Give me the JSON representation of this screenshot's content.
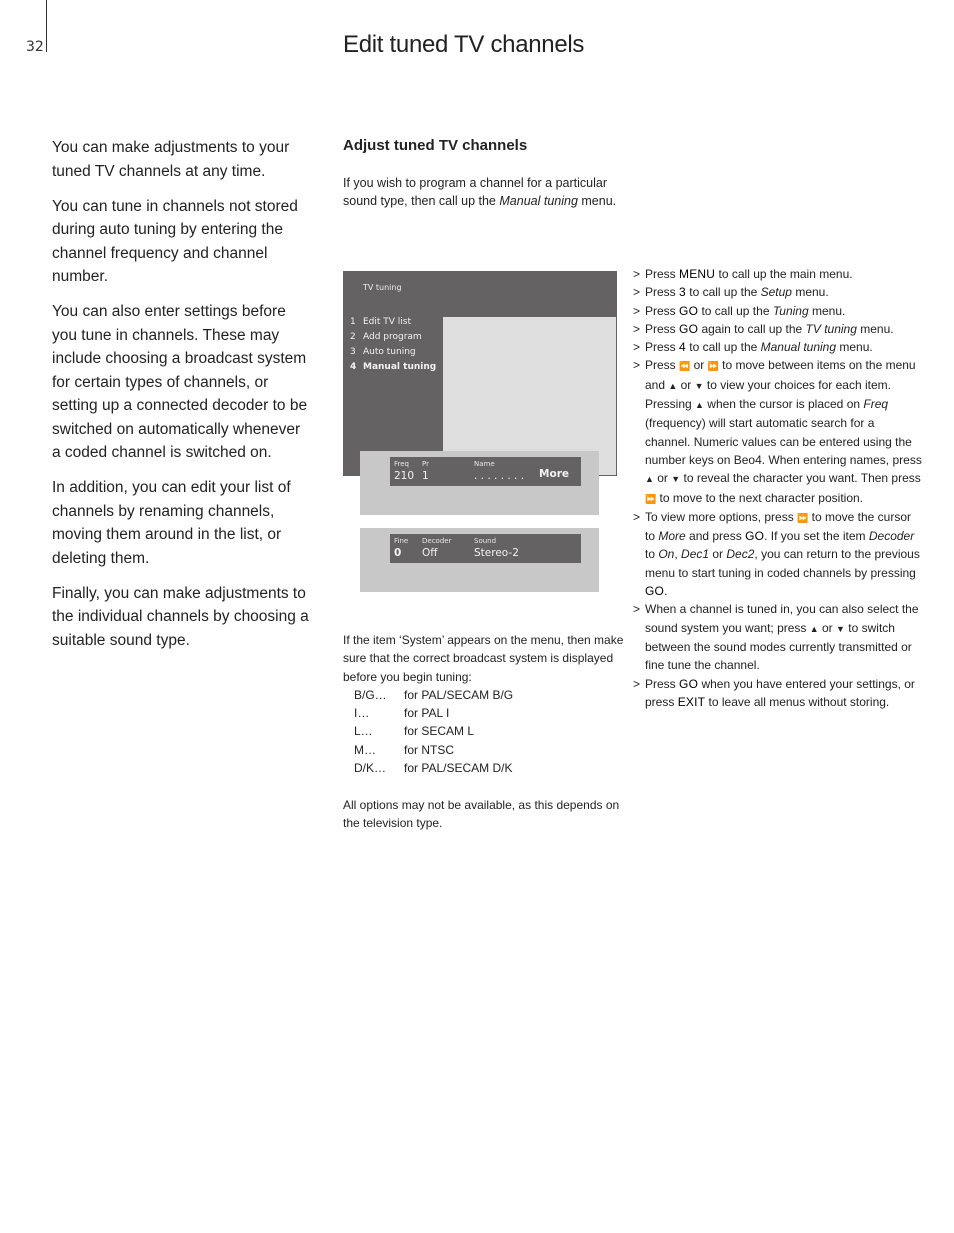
{
  "header": {
    "page_number": "32",
    "title": "Edit tuned TV channels"
  },
  "intro": {
    "paragraphs": [
      "You can make adjustments to your tuned TV channels at any time.",
      "You can tune in channels not stored during auto tuning by entering the channel frequency and channel number.",
      "You can also enter settings before you tune in channels. These may include choosing a broadcast system for certain types of channels, or setting up a connected decoder to be switched on automatically whenever a coded channel is switched on.",
      "In addition, you can edit your list of channels by renaming channels, moving them around in the list, or deleting them.",
      "Finally, you can make adjustments to the individual channels by choosing a suitable sound type."
    ]
  },
  "section": {
    "heading": "Adjust tuned TV channels",
    "lead_pre": "If you wish to program a channel for a particular sound type, then call up the ",
    "lead_em": "Manual tuning",
    "lead_post": " menu."
  },
  "tv_menu": {
    "title": "TV tuning",
    "items": [
      {
        "num": "1",
        "label": "Edit TV list"
      },
      {
        "num": "2",
        "label": "Add program"
      },
      {
        "num": "3",
        "label": "Auto tuning"
      },
      {
        "num": "4",
        "label": "Manual tuning"
      }
    ],
    "panel1": {
      "freq_label": "Freq",
      "freq_value": "210",
      "pr_label": "Pr",
      "pr_value": "1",
      "name_label": "Name",
      "name_value": ". . . . . . . .",
      "more_label": "More"
    },
    "panel2": {
      "fine_label": "Fine",
      "fine_value": "0",
      "decoder_label": "Decoder",
      "decoder_value": "Off",
      "sound_label": "Sound",
      "sound_value": "Stereo-2"
    }
  },
  "steps": {
    "marker": ">",
    "press": "Press",
    "s1": {
      "key": "MENU",
      "text": " to call up the main menu."
    },
    "s2": {
      "key": "3",
      "pre": " to call up the ",
      "em": "Setup",
      "post": " menu."
    },
    "s3": {
      "key": "GO",
      "pre": " to call up the ",
      "em": "Tuning",
      "post": " menu."
    },
    "s4": {
      "key": "GO",
      "pre": " again to call up the ",
      "em": "TV tuning",
      "post": " menu."
    },
    "s5": {
      "key": "4",
      "pre": " to call up the ",
      "em": "Manual tuning",
      "post": " menu."
    },
    "s6": {
      "a": " or ",
      "b": " to move between items on the menu and ",
      "c": " or ",
      "d": " to view your choices for each item. Pressing ",
      "e": " when the cursor is placed on ",
      "em1": "Freq",
      "f": " (frequency) will start automatic search for a channel. Numeric values can be entered using the number keys on Beo4. When entering names, press ",
      "g": " or ",
      "h": " to reveal the character you want. Then press ",
      "i": " to move to the next character position."
    },
    "s7": {
      "a": "To view more options, press ",
      "b": " to move the cursor to ",
      "em1": "More",
      "c": " and press ",
      "key1": "GO",
      "d": ". If you set the item ",
      "em2": "Decoder",
      "e": " to ",
      "em3": "On",
      "f": ", ",
      "em4": "Dec1",
      "g": " or ",
      "em5": "Dec2",
      "h": ", you can return to the previous menu to start tuning in coded channels by pressing ",
      "key2": "GO",
      "i": "."
    },
    "s8": {
      "a": "When a channel is tuned in, you can also select the sound system you want; press ",
      "b": " or ",
      "c": " to switch between the sound modes currently transmitted or fine tune the channel."
    },
    "s9": {
      "key1": "GO",
      "a": " when you have entered your settings, or press ",
      "key2": "EXIT",
      "b": " to leave all menus without storing."
    },
    "icons": {
      "rewind": "⏪",
      "forward": "⏩",
      "up": "▲",
      "down": "▼"
    }
  },
  "system": {
    "intro": "If the item ‘System’ appears on the menu, then make sure that the correct broadcast system is displayed before you begin tuning:",
    "rows": [
      {
        "code": "B/G…",
        "desc": "for PAL/SECAM B/G"
      },
      {
        "code": "I…",
        "desc": "for PAL I"
      },
      {
        "code": "L…",
        "desc": "for SECAM L"
      },
      {
        "code": "M…",
        "desc": "for NTSC"
      },
      {
        "code": "D/K…",
        "desc": "for PAL/SECAM D/K"
      }
    ],
    "note": "All options may not be available, as this depends on the television type."
  }
}
